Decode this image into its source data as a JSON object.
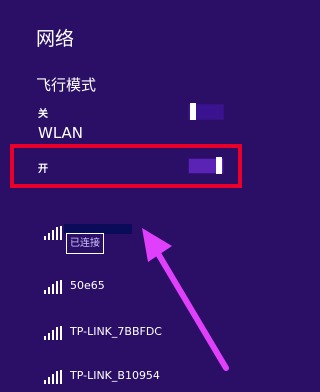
{
  "panel": {
    "title": "网络"
  },
  "airplane": {
    "heading": "飞行模式",
    "state_label": "关",
    "on": false
  },
  "wlan": {
    "heading": "WLAN",
    "state_label": "开",
    "on": true
  },
  "networks": [
    {
      "name": "",
      "status": "已连接",
      "signal": 5
    },
    {
      "name": "50e65",
      "signal": 5
    },
    {
      "name": "TP-LINK_7BBFDC",
      "signal": 5
    },
    {
      "name": "TP-LINK_B10954",
      "signal": 5
    }
  ],
  "colors": {
    "background": "#2b0f66",
    "highlight": "#e8002a",
    "arrow": "#e040fb"
  }
}
